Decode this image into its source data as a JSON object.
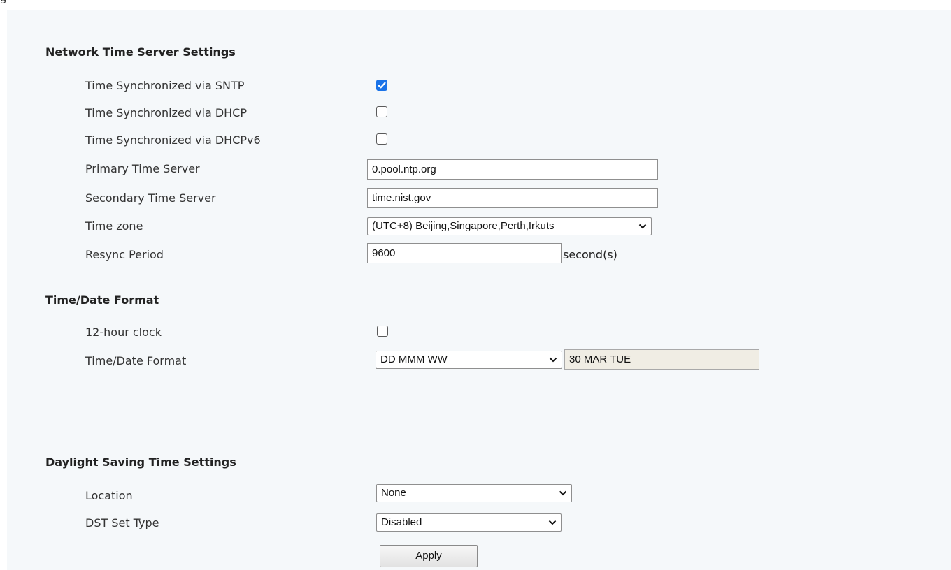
{
  "top_fragment": "g",
  "network_time": {
    "title": "Network Time Server Settings",
    "sntp_label": "Time Synchronized via SNTP",
    "sntp_checked": true,
    "dhcp_label": "Time Synchronized via DHCP",
    "dhcp_checked": false,
    "dhcpv6_label": "Time Synchronized via DHCPv6",
    "dhcpv6_checked": false,
    "primary_label": "Primary Time Server",
    "primary_value": "0.pool.ntp.org",
    "secondary_label": "Secondary Time Server",
    "secondary_value": "time.nist.gov",
    "timezone_label": "Time zone",
    "timezone_value": "(UTC+8) Beijing,Singapore,Perth,Irkuts",
    "resync_label": "Resync Period",
    "resync_value": "9600",
    "resync_unit": "second(s)"
  },
  "time_date_format": {
    "title": "Time/Date Format",
    "clock12_label": "12-hour clock",
    "clock12_checked": false,
    "format_label": "Time/Date Format",
    "format_value": "DD MMM WW",
    "format_preview": "30 MAR TUE"
  },
  "dst": {
    "title": "Daylight Saving Time Settings",
    "location_label": "Location",
    "location_value": "None",
    "set_type_label": "DST Set Type",
    "set_type_value": "Disabled",
    "apply_label": "Apply"
  },
  "colors": {
    "panel_bg": "#f5f8fa",
    "checkbox_accent": "#1a73e8",
    "readonly_bg": "#f0ede4"
  }
}
